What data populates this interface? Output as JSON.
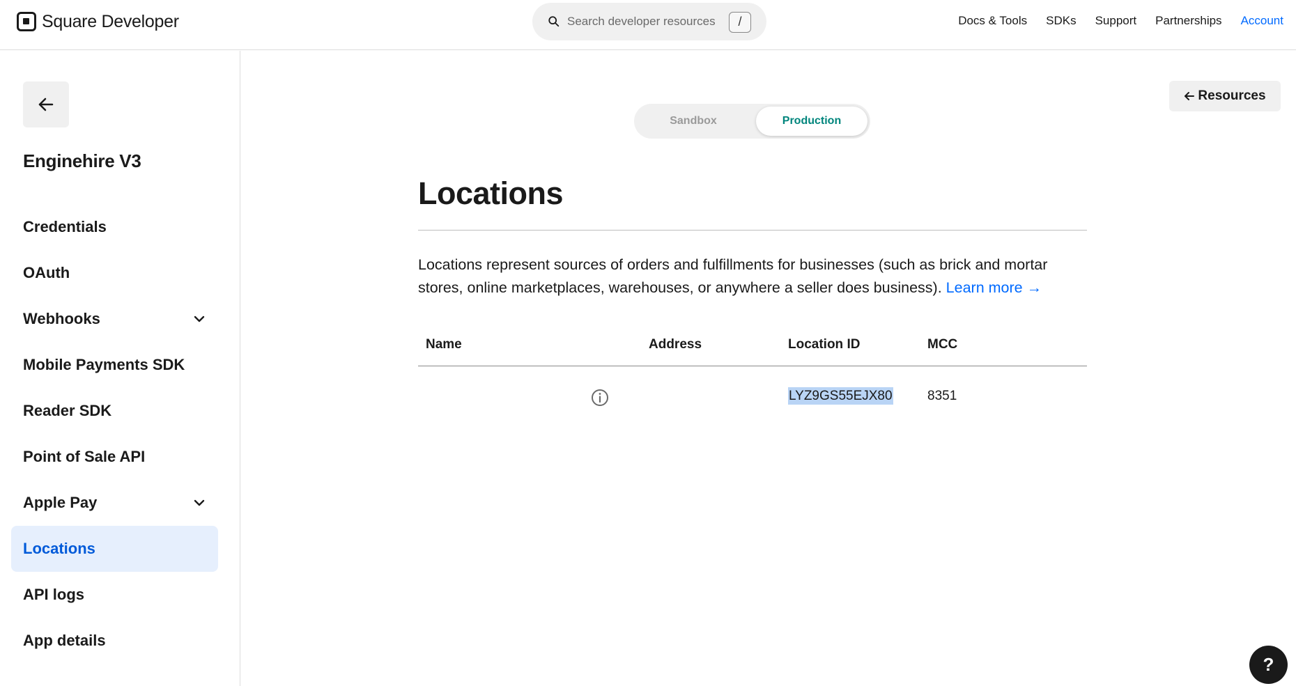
{
  "header": {
    "logo_text": "Square Developer",
    "search_placeholder": "Search developer resources",
    "search_shortcut": "/",
    "nav": [
      "Docs & Tools",
      "SDKs",
      "Support",
      "Partnerships",
      "Account"
    ]
  },
  "sidebar": {
    "app_name": "Enginehire V3",
    "items": [
      {
        "label": "Credentials"
      },
      {
        "label": "OAuth"
      },
      {
        "label": "Webhooks"
      },
      {
        "label": "Mobile Payments SDK"
      },
      {
        "label": "Reader SDK"
      },
      {
        "label": "Point of Sale API"
      },
      {
        "label": "Apple Pay"
      },
      {
        "label": "Locations"
      },
      {
        "label": "API logs"
      },
      {
        "label": "App details"
      }
    ],
    "active": "Locations"
  },
  "main": {
    "resources_label": "Resources",
    "env_options": [
      "Sandbox",
      "Production"
    ],
    "env_selected": "Production",
    "title": "Locations",
    "description": "Locations represent sources of orders and fulfillments for businesses (such as brick and mortar stores, online marketplaces, warehouses, or anywhere a seller does business).",
    "learn_more": "Learn more →",
    "table": {
      "headers": [
        "Name",
        "Address",
        "Location ID",
        "MCC"
      ],
      "rows": [
        {
          "name": "",
          "address": "",
          "location_id": "LYZ9GS55EJX80",
          "mcc": "8351"
        }
      ]
    }
  },
  "help_label": "?",
  "colors": {
    "accent": "#006aff",
    "active_nav_bg": "#e6effd",
    "production": "#00857c",
    "selection": "#b9d4f5"
  }
}
